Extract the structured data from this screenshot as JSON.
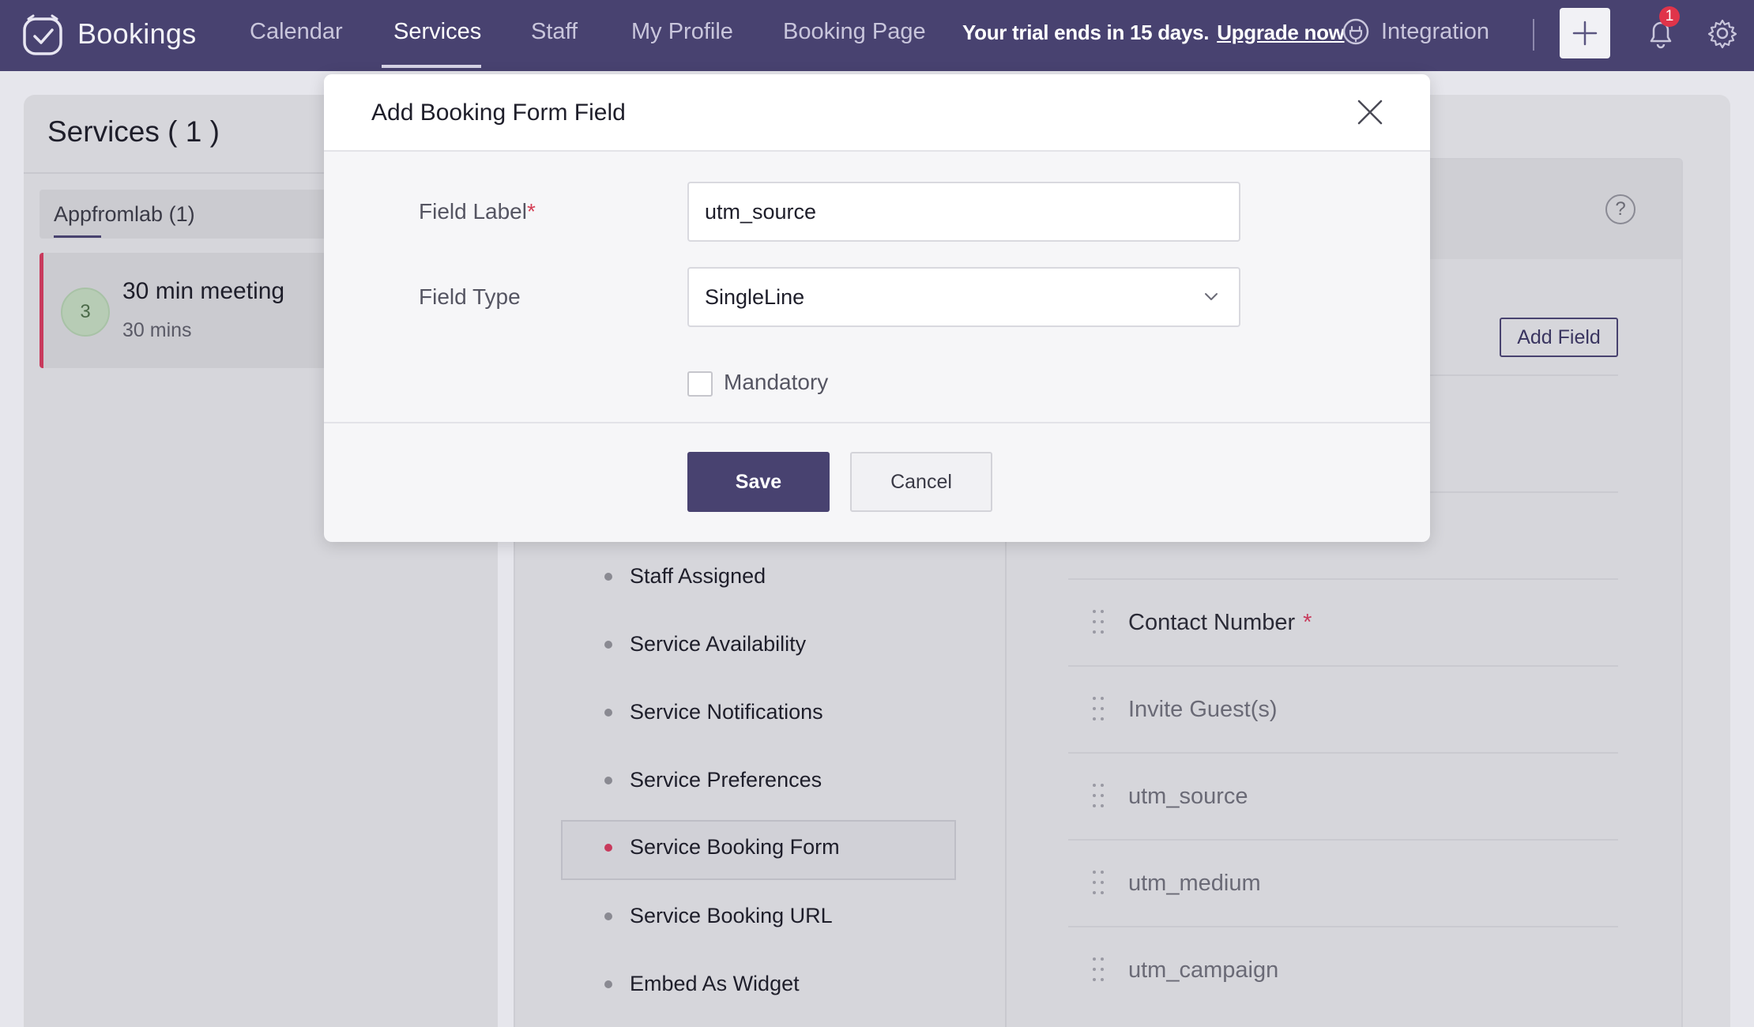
{
  "app": {
    "name": "Bookings",
    "logo_icon": "bookings-logo-icon"
  },
  "nav": {
    "items": [
      {
        "label": "Calendar"
      },
      {
        "label": "Services"
      },
      {
        "label": "Staff"
      },
      {
        "label": "My Profile"
      },
      {
        "label": "Booking Page"
      }
    ],
    "active": "Services",
    "trial_text": "Your trial ends in 15 days.",
    "upgrade_label": "Upgrade now",
    "integration_label": "Integration",
    "notification_count": "1"
  },
  "services_panel": {
    "title": "Services ( 1 )",
    "group_tab": "Appfromlab (1)",
    "service": {
      "avatar_text": "3",
      "name": "30 min meeting",
      "duration": "30 mins"
    }
  },
  "side_menu": {
    "items": [
      {
        "label": "Staff Assigned"
      },
      {
        "label": "Service Availability"
      },
      {
        "label": "Service Notifications"
      },
      {
        "label": "Service Preferences"
      },
      {
        "label": "Service Booking Form"
      },
      {
        "label": "Service Booking URL"
      },
      {
        "label": "Embed As Widget"
      }
    ],
    "selected": "Service Booking Form"
  },
  "booking_form": {
    "add_field_label": "Add Field",
    "fields": [
      {
        "label": "Contact Number",
        "required_mark": "*"
      },
      {
        "label": "Invite Guest(s)"
      },
      {
        "label": "utm_source"
      },
      {
        "label": "utm_medium"
      },
      {
        "label": "utm_campaign"
      }
    ]
  },
  "modal": {
    "title": "Add Booking Form Field",
    "field_label": "Field Label",
    "required_mark": "*",
    "field_label_value": "utm_source",
    "field_type_label": "Field Type",
    "field_type_value": "SingleLine",
    "mandatory_label": "Mandatory",
    "mandatory_checked": false,
    "save_label": "Save",
    "cancel_label": "Cancel"
  },
  "colors": {
    "topbar": "#484270",
    "primary": "#484270",
    "accent_red": "#c83a5c",
    "badge": "#e0344a"
  }
}
